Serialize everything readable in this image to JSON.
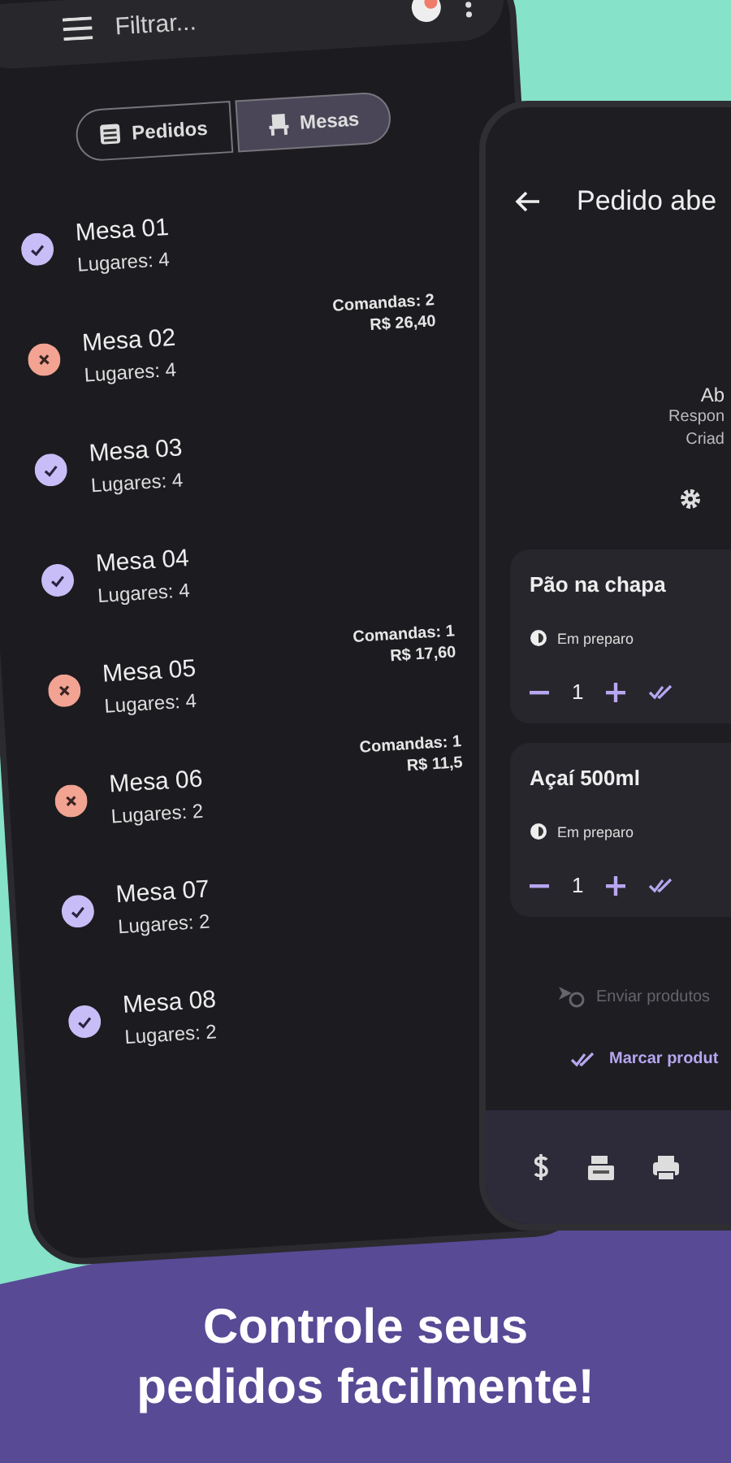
{
  "list_screen": {
    "search": {
      "placeholder": "Filtrar..."
    },
    "segments": [
      {
        "label": "Pedidos",
        "selected": false
      },
      {
        "label": "Mesas",
        "selected": true
      }
    ],
    "tables": [
      {
        "name": "Mesa 01",
        "seats": "Lugares: 4",
        "occupied": false
      },
      {
        "name": "Mesa 02",
        "seats": "Lugares: 4",
        "occupied": true,
        "tabs": "Comandas: 2",
        "total": "R$ 26,40"
      },
      {
        "name": "Mesa 03",
        "seats": "Lugares: 4",
        "occupied": false
      },
      {
        "name": "Mesa 04",
        "seats": "Lugares: 4",
        "occupied": false
      },
      {
        "name": "Mesa 05",
        "seats": "Lugares: 4",
        "occupied": true,
        "tabs": "Comandas: 1",
        "total": "R$ 17,60"
      },
      {
        "name": "Mesa 06",
        "seats": "Lugares: 2",
        "occupied": true,
        "tabs": "Comandas: 1",
        "total": "R$ 11,5"
      },
      {
        "name": "Mesa 07",
        "seats": "Lugares: 2",
        "occupied": false
      },
      {
        "name": "Mesa 08",
        "seats": "Lugares: 2",
        "occupied": false
      }
    ]
  },
  "order_screen": {
    "title": "Pedido abe",
    "summary": [
      "Ab",
      "Respon",
      "Criad"
    ],
    "items": [
      {
        "name": "Pão na chapa",
        "status": "Em preparo",
        "quantity": "1"
      },
      {
        "name": "Açaí 500ml",
        "status": "Em preparo",
        "quantity": "1"
      }
    ],
    "actions": [
      {
        "label": "Enviar produtos",
        "disabled": true
      },
      {
        "label": "Marcar produt",
        "disabled": false
      }
    ]
  },
  "headline": "Controle seus pedidos facilmente!"
}
